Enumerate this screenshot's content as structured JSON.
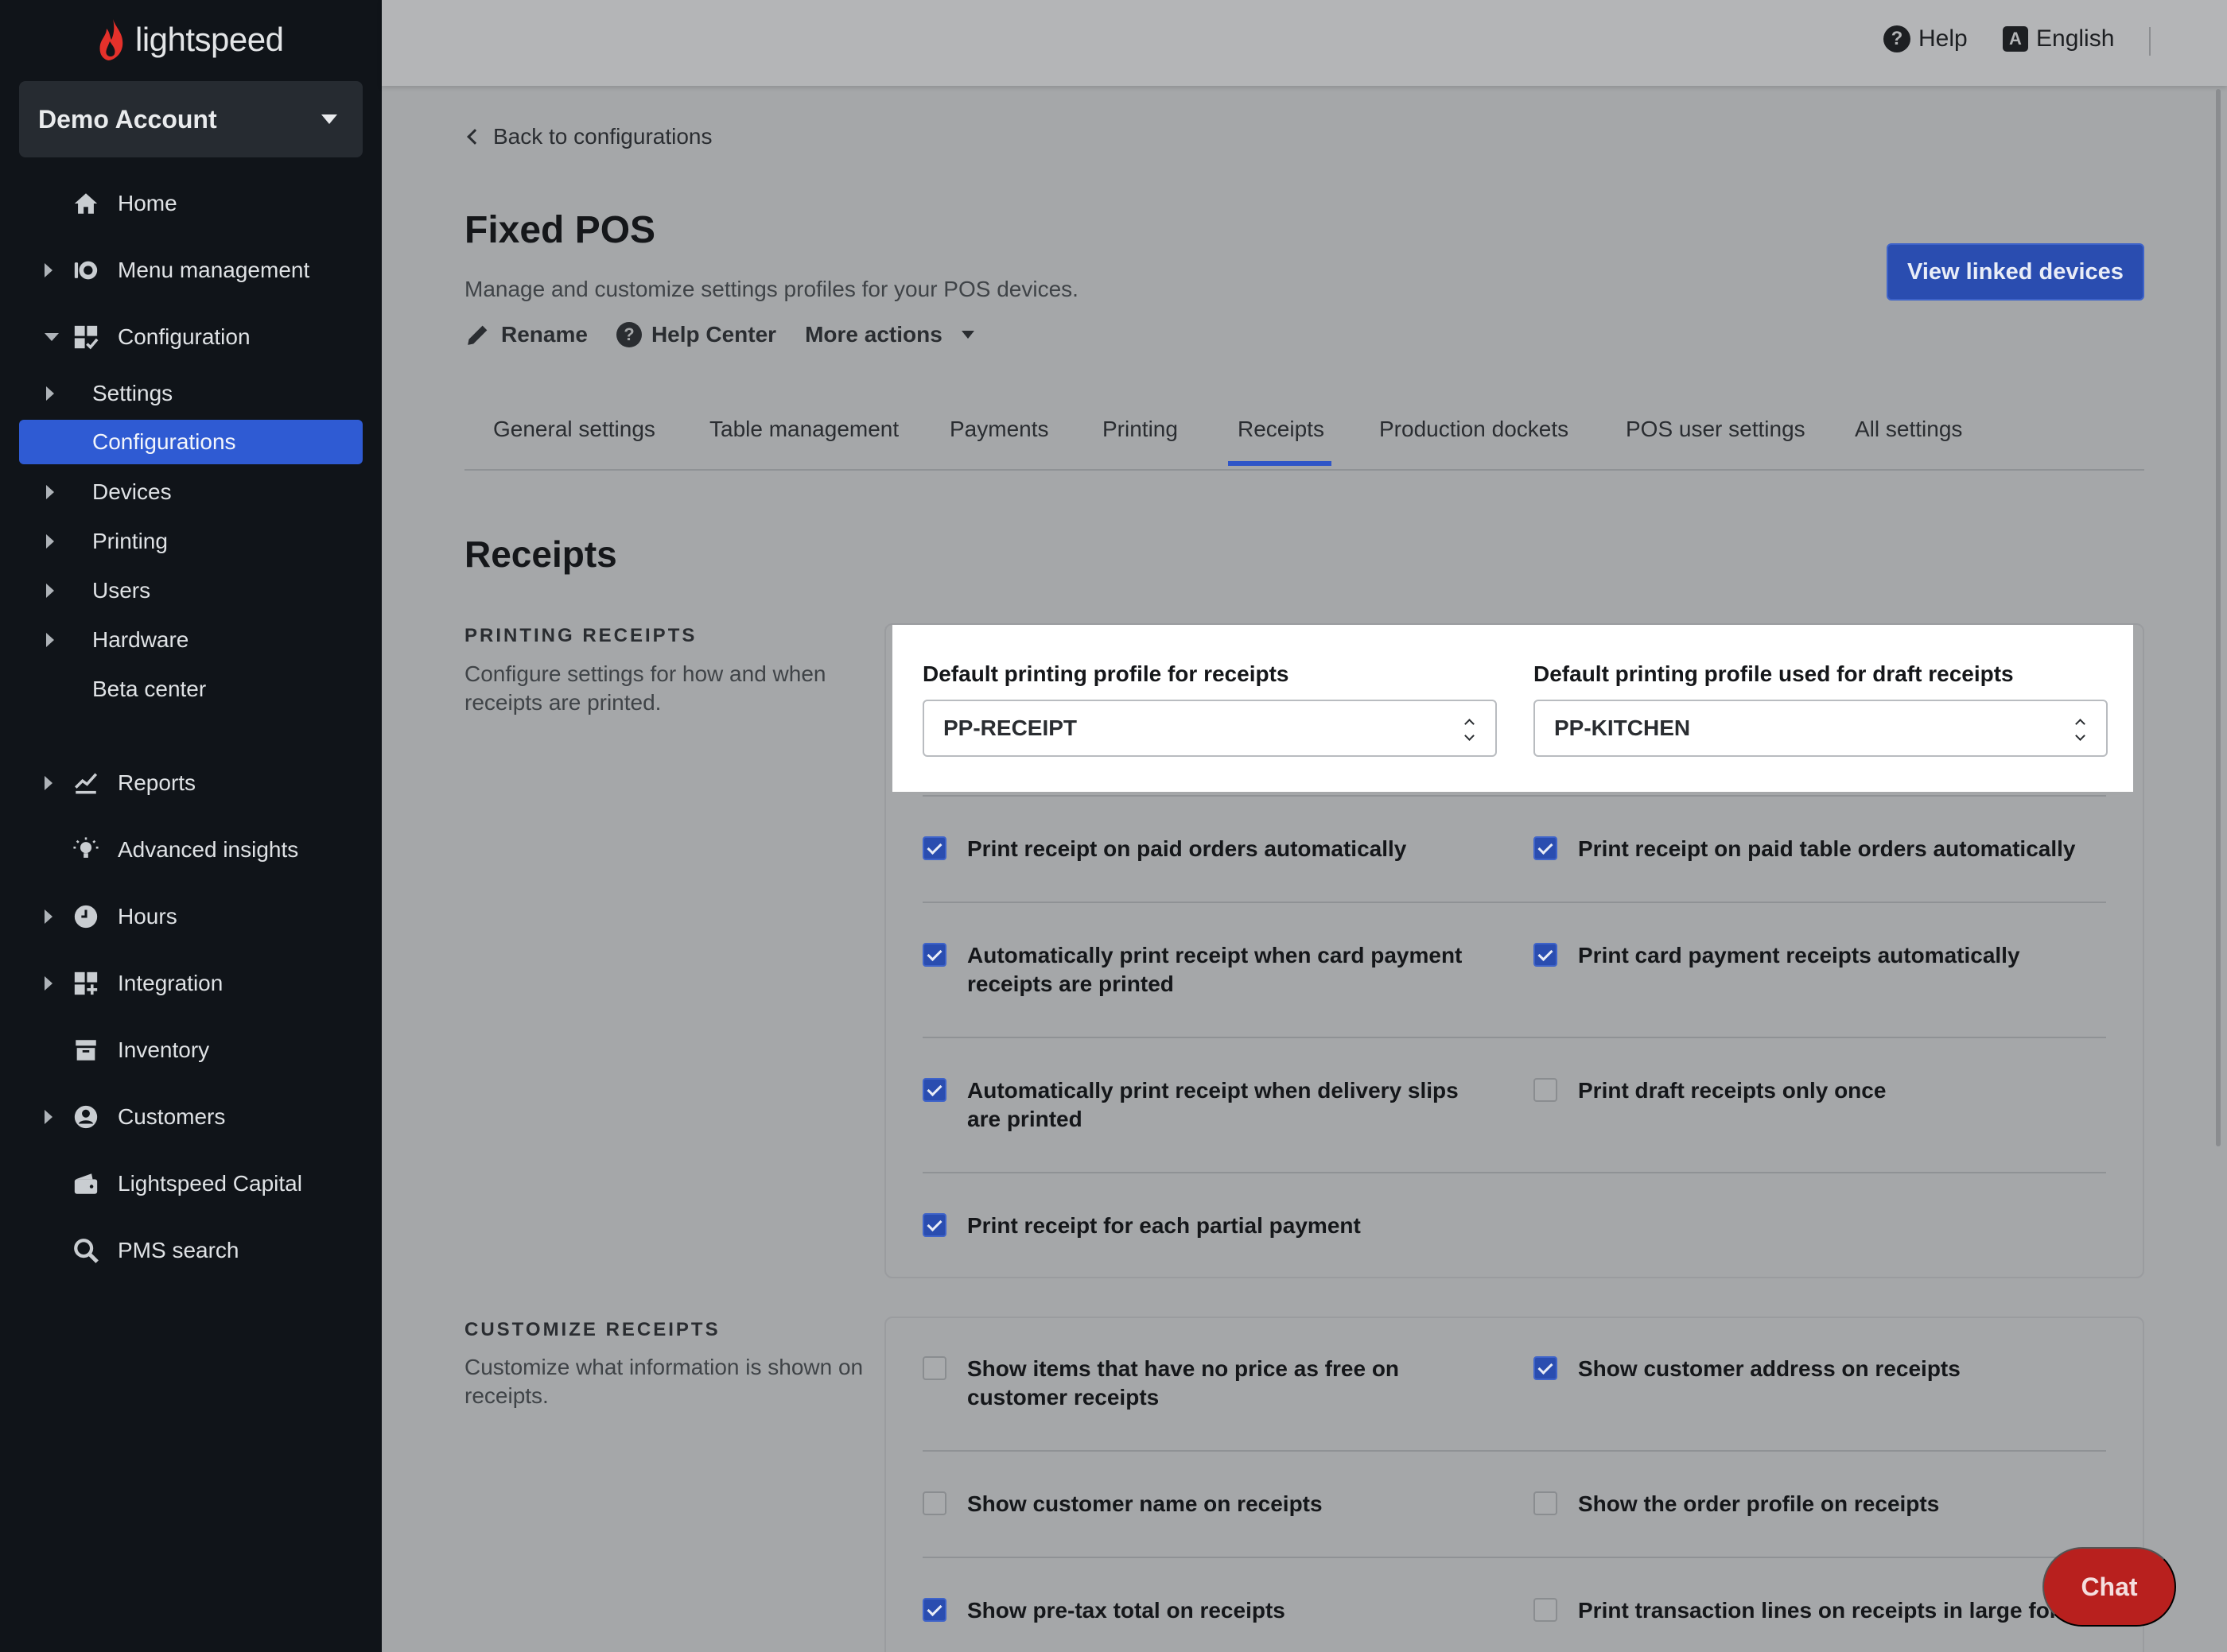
{
  "brand": {
    "name": "lightspeed",
    "accent": "#e4312b"
  },
  "sidebar": {
    "account": "Demo Account",
    "items": [
      {
        "label": "Home",
        "icon": "home-icon"
      },
      {
        "label": "Menu management",
        "icon": "menu-icon"
      },
      {
        "label": "Configuration",
        "icon": "configuration-icon"
      },
      {
        "label": "Reports",
        "icon": "reports-icon"
      },
      {
        "label": "Advanced insights",
        "icon": "lightbulb-icon"
      },
      {
        "label": "Hours",
        "icon": "clock-icon"
      },
      {
        "label": "Integration",
        "icon": "integration-icon"
      },
      {
        "label": "Inventory",
        "icon": "inventory-icon"
      },
      {
        "label": "Customers",
        "icon": "customer-icon"
      },
      {
        "label": "Lightspeed Capital",
        "icon": "wallet-icon"
      },
      {
        "label": "PMS search",
        "icon": "search-icon"
      }
    ],
    "subitems": [
      "Settings",
      "Configurations",
      "Devices",
      "Printing",
      "Users",
      "Hardware",
      "Beta center"
    ],
    "active_subitem": "Configurations"
  },
  "topbar": {
    "help": "Help",
    "language": "English",
    "language_icon_letter": "A"
  },
  "page": {
    "back_link": "Back to configurations",
    "title": "Fixed POS",
    "subtitle": "Manage and customize settings profiles for your POS devices.",
    "actions": {
      "rename": "Rename",
      "help_center": "Help Center",
      "more_actions": "More actions"
    },
    "primary_button": "View linked devices"
  },
  "tabs": [
    "General settings",
    "Table management",
    "Payments",
    "Printing",
    "Receipts",
    "Production dockets",
    "POS user settings",
    "All settings"
  ],
  "active_tab": "Receipts",
  "section_title": "Receipts",
  "printing_receipts": {
    "heading": "PRINTING RECEIPTS",
    "description": "Configure settings for how and when receipts are printed.",
    "select_receipts": {
      "label": "Default printing profile for receipts",
      "value": "PP-RECEIPT"
    },
    "select_draft": {
      "label": "Default printing profile used for draft receipts",
      "value": "PP-KITCHEN"
    },
    "options": [
      {
        "label": "Print receipt on paid orders automatically",
        "checked": true
      },
      {
        "label": "Print receipt on paid table orders automatically",
        "checked": true
      },
      {
        "label": "Automatically print receipt when card payment receipts are printed",
        "checked": true
      },
      {
        "label": "Print card payment receipts automatically",
        "checked": true
      },
      {
        "label": "Automatically print receipt when delivery slips are printed",
        "checked": true
      },
      {
        "label": "Print draft receipts only once",
        "checked": false
      },
      {
        "label": "Print receipt for each partial payment",
        "checked": true
      }
    ]
  },
  "customize_receipts": {
    "heading": "CUSTOMIZE RECEIPTS",
    "description": "Customize what information is shown on receipts.",
    "options": [
      {
        "label": "Show items that have no price as free on customer receipts",
        "checked": false
      },
      {
        "label": "Show customer address on receipts",
        "checked": true
      },
      {
        "label": "Show customer name on receipts",
        "checked": false
      },
      {
        "label": "Show the order profile on receipts",
        "checked": false
      },
      {
        "label": "Show pre-tax total on receipts",
        "checked": true
      },
      {
        "label": "Print transaction lines on receipts in large font",
        "checked": false
      }
    ]
  },
  "chat": "Chat"
}
